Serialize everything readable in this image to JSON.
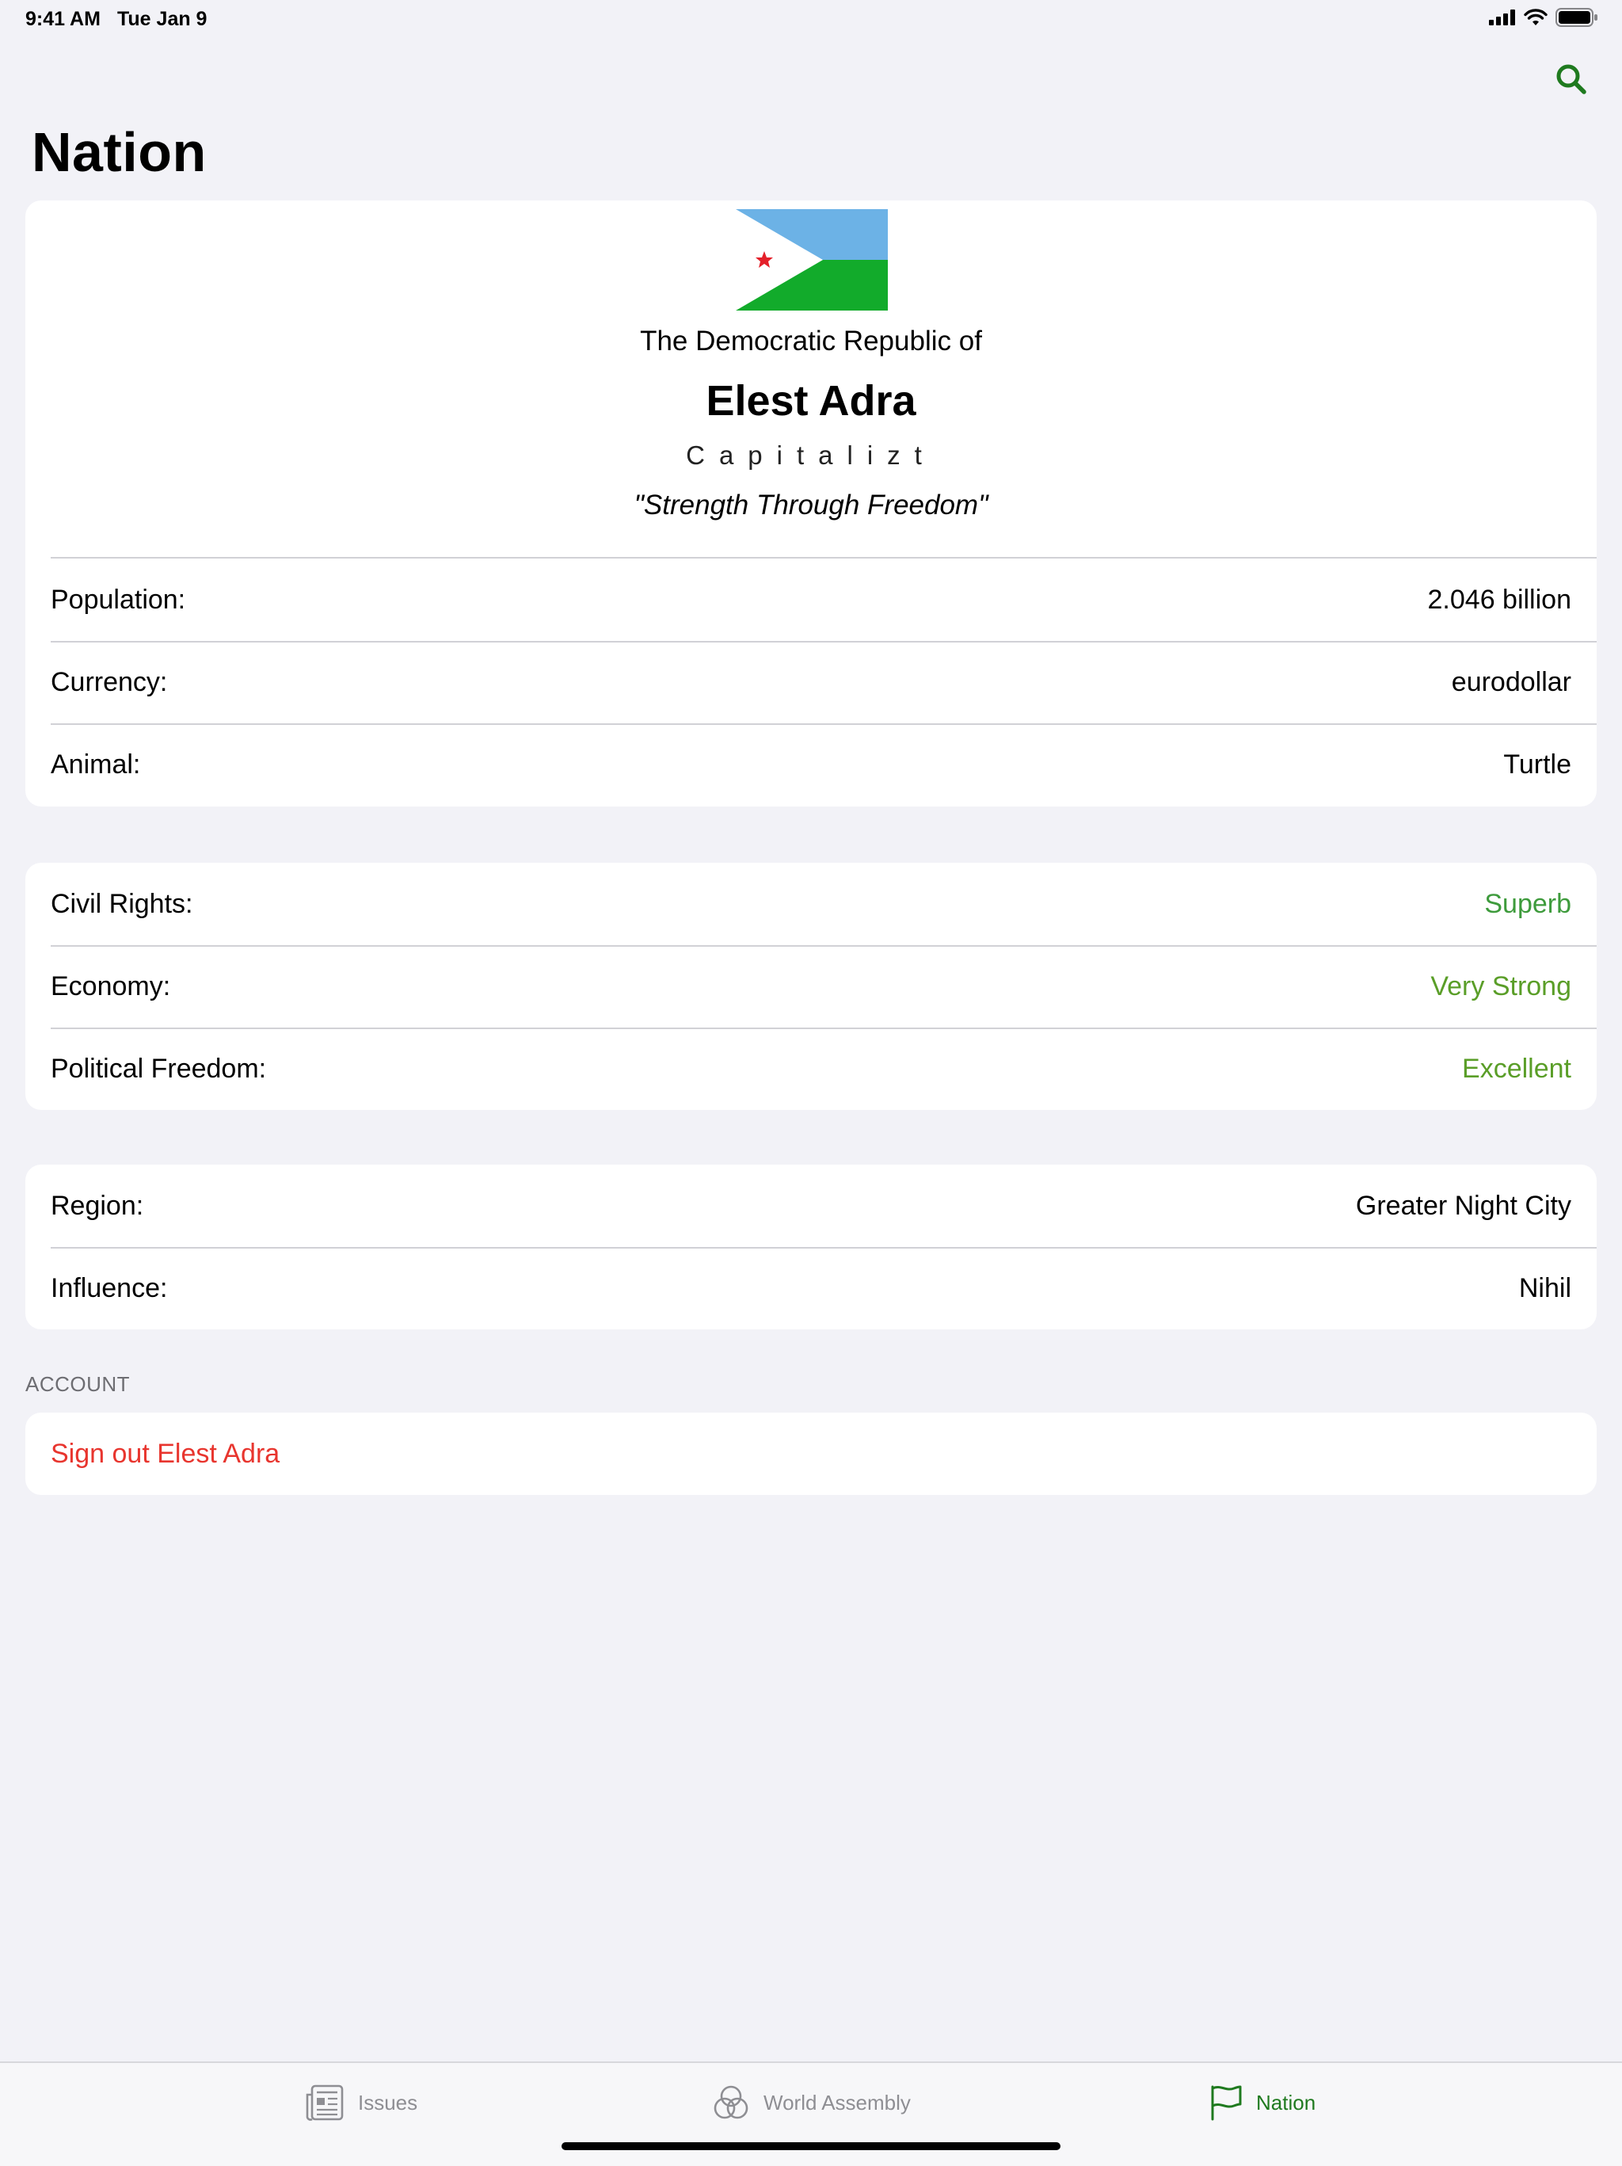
{
  "status_bar": {
    "time": "9:41 AM",
    "date": "Tue Jan 9"
  },
  "header": {
    "title": "Nation"
  },
  "nation": {
    "pretitle": "The Democratic Republic of",
    "name": "Elest Adra",
    "category": "Capitalizt",
    "motto": "\"Strength Through Freedom\""
  },
  "basic_info": [
    {
      "label": "Population:",
      "value": "2.046 billion"
    },
    {
      "label": "Currency:",
      "value": "eurodollar"
    },
    {
      "label": "Animal:",
      "value": "Turtle"
    }
  ],
  "ratings": [
    {
      "label": "Civil Rights:",
      "value": "Superb"
    },
    {
      "label": "Economy:",
      "value": "Very Strong"
    },
    {
      "label": "Political Freedom:",
      "value": "Excellent"
    }
  ],
  "region_info": [
    {
      "label": "Region:",
      "value": "Greater Night City"
    },
    {
      "label": "Influence:",
      "value": "Nihil"
    }
  ],
  "account": {
    "section_title": "ACCOUNT",
    "sign_out_label": "Sign out Elest Adra"
  },
  "tabs": [
    {
      "label": "Issues",
      "icon": "newspaper-icon"
    },
    {
      "label": "World Assembly",
      "icon": "venn-circles-icon"
    },
    {
      "label": "Nation",
      "icon": "flag-icon"
    }
  ],
  "colors": {
    "accent": "#1f7a1f",
    "destructive": "#e8352e",
    "rating_green": "#3e9b3c",
    "background": "#f2f2f7"
  }
}
